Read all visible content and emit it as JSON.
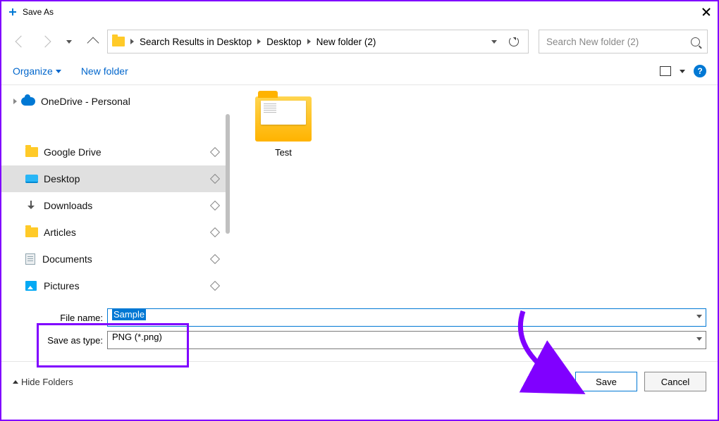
{
  "title": "Save As",
  "breadcrumbs": [
    "Search Results in Desktop",
    "Desktop",
    "New folder (2)"
  ],
  "search": {
    "placeholder": "Search New folder (2)"
  },
  "toolbar": {
    "organize": "Organize",
    "new_folder": "New folder"
  },
  "sidebar": {
    "onedrive": "OneDrive - Personal",
    "google_drive": "Google Drive",
    "desktop": "Desktop",
    "downloads": "Downloads",
    "articles": "Articles",
    "documents": "Documents",
    "pictures": "Pictures"
  },
  "content": {
    "folder_name": "Test"
  },
  "fields": {
    "filename_label": "File name:",
    "filename_value": "Sample",
    "type_label": "Save as type:",
    "type_value": "PNG (*.png)"
  },
  "footer": {
    "hide_folders": "Hide Folders",
    "save": "Save",
    "cancel": "Cancel"
  }
}
